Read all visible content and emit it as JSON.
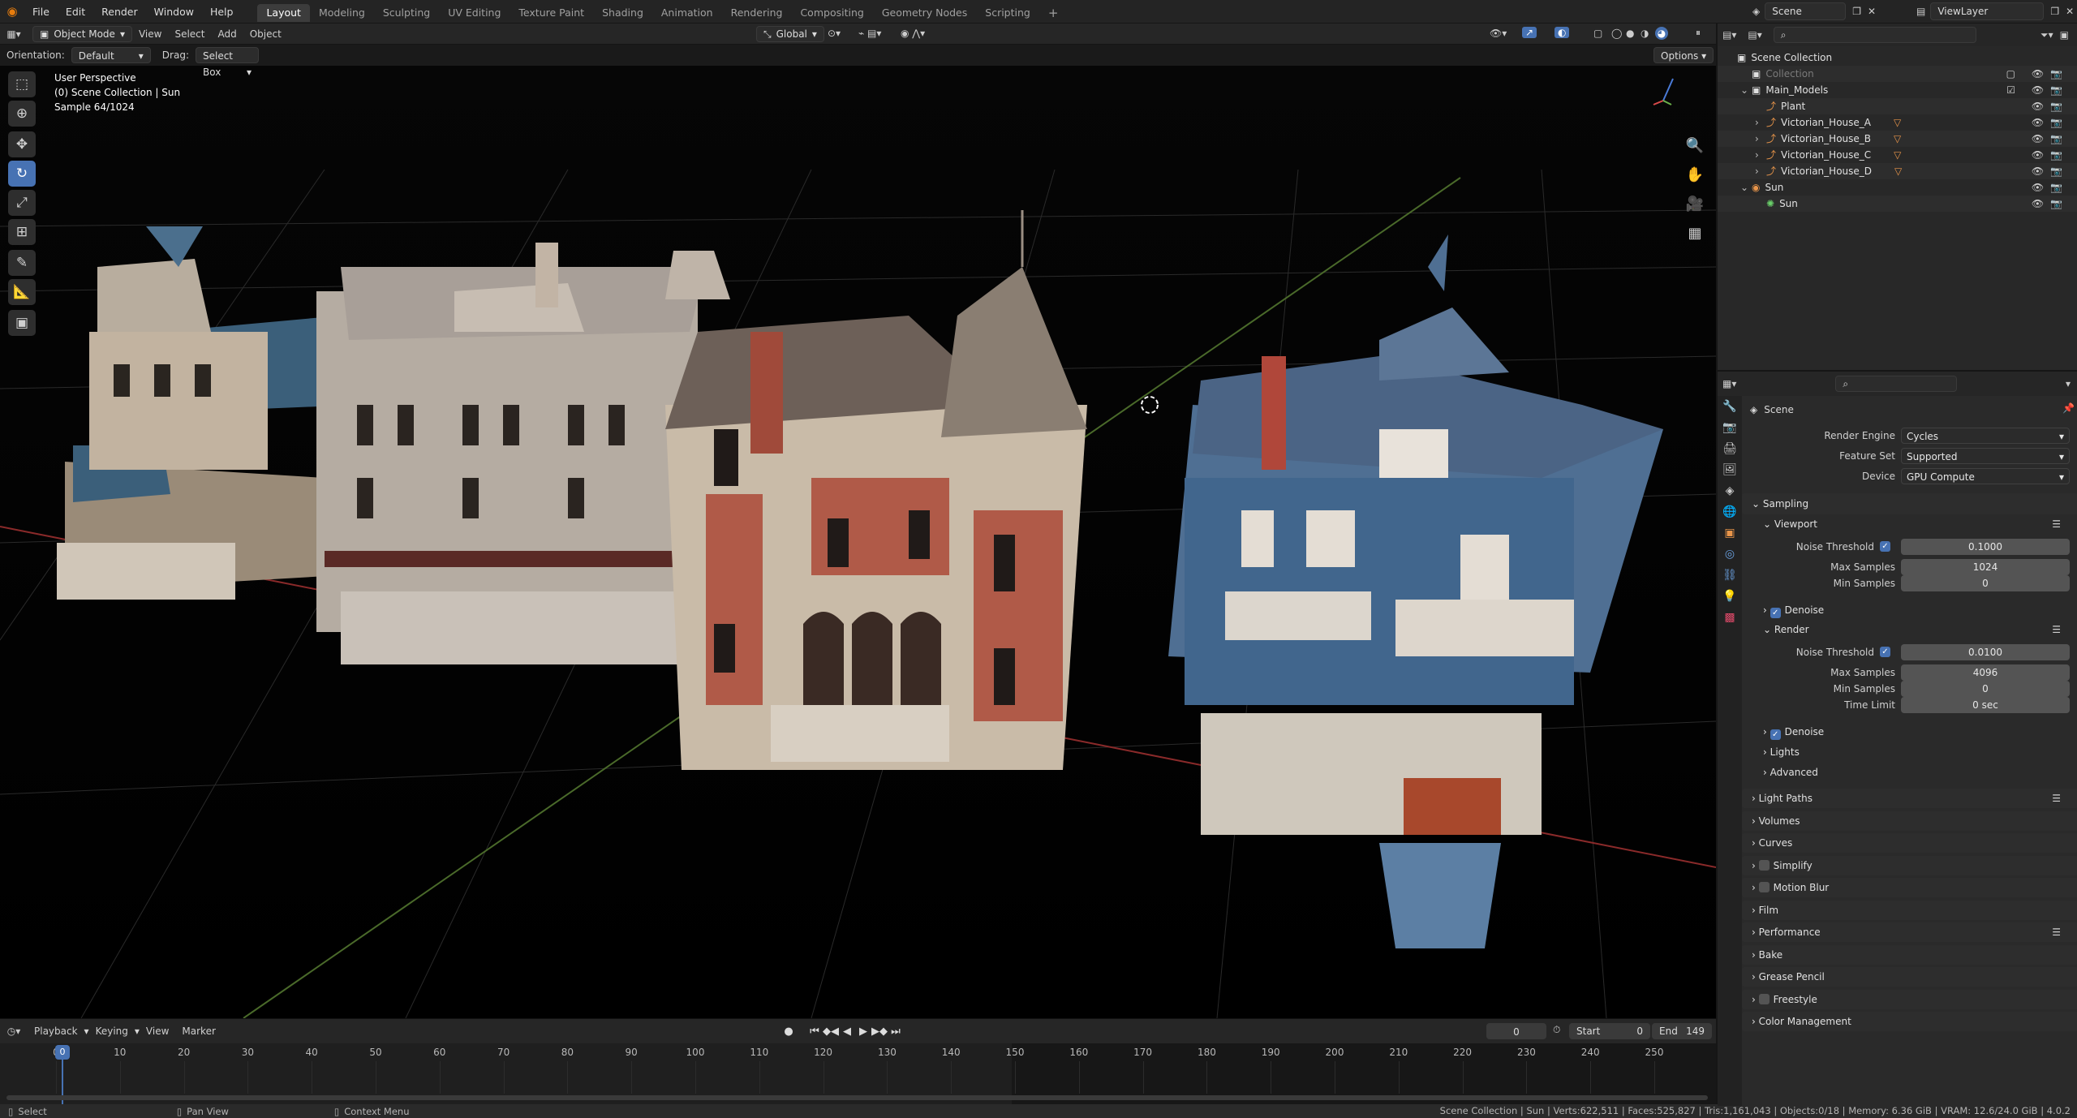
{
  "menus": [
    "File",
    "Edit",
    "Render",
    "Window",
    "Help"
  ],
  "workspaces": [
    "Layout",
    "Modeling",
    "Sculpting",
    "UV Editing",
    "Texture Paint",
    "Shading",
    "Animation",
    "Rendering",
    "Compositing",
    "Geometry Nodes",
    "Scripting"
  ],
  "active_workspace": "Layout",
  "scene_selector": "Scene",
  "viewlayer_selector": "ViewLayer",
  "viewport": {
    "mode": "Object Mode",
    "header_menus": [
      "View",
      "Select",
      "Add",
      "Object"
    ],
    "transform_orientation": "Global",
    "orientation_label": "Orientation:",
    "orientation_value": "Default",
    "drag_label": "Drag:",
    "drag_value": "Select Box",
    "options_label": "Options",
    "overlay_line1": "User Perspective",
    "overlay_line2": "(0) Scene Collection | Sun",
    "overlay_line3": "Sample 64/1024"
  },
  "outliner": {
    "rows": [
      {
        "label": "Scene Collection",
        "indent": 0,
        "icon": "collection"
      },
      {
        "label": "Collection",
        "indent": 1,
        "icon": "collection",
        "dim": true
      },
      {
        "label": "Main_Models",
        "indent": 1,
        "icon": "collection"
      },
      {
        "label": "Plant",
        "indent": 2,
        "icon": "object"
      },
      {
        "label": "Victorian_House_A",
        "indent": 2,
        "icon": "object"
      },
      {
        "label": "Victorian_House_B",
        "indent": 2,
        "icon": "object"
      },
      {
        "label": "Victorian_House_C",
        "indent": 2,
        "icon": "object"
      },
      {
        "label": "Victorian_House_D",
        "indent": 2,
        "icon": "object"
      },
      {
        "label": "Sun",
        "indent": 1,
        "icon": "light"
      },
      {
        "label": "Sun",
        "indent": 2,
        "icon": "light-data"
      }
    ]
  },
  "properties": {
    "context": "Scene",
    "render_engine_label": "Render Engine",
    "render_engine": "Cycles",
    "feature_set_label": "Feature Set",
    "feature_set": "Supported",
    "device_label": "Device",
    "device": "GPU Compute",
    "sampling": "Sampling",
    "viewport": "Viewport",
    "noise_threshold_label": "Noise Threshold",
    "vp_noise_threshold": "0.1000",
    "max_samples_label": "Max Samples",
    "vp_max_samples": "1024",
    "min_samples_label": "Min Samples",
    "vp_min_samples": "0",
    "denoise": "Denoise",
    "render": "Render",
    "r_noise_threshold": "0.0100",
    "r_max_samples": "4096",
    "r_min_samples": "0",
    "time_limit_label": "Time Limit",
    "r_time_limit": "0 sec",
    "lights": "Lights",
    "advanced": "Advanced",
    "sections": [
      "Light Paths",
      "Volumes",
      "Curves",
      "Simplify",
      "Motion Blur",
      "Film",
      "Performance",
      "Bake",
      "Grease Pencil",
      "Freestyle",
      "Color Management"
    ]
  },
  "timeline": {
    "menus": [
      "Playback",
      "Keying",
      "View",
      "Marker"
    ],
    "current_frame": "0",
    "start_label": "Start",
    "start": "0",
    "end_label": "End",
    "end": "149",
    "ticks": [
      "0",
      "10",
      "20",
      "30",
      "40",
      "50",
      "60",
      "70",
      "80",
      "90",
      "100",
      "110",
      "120",
      "130",
      "140",
      "150",
      "160",
      "170",
      "180",
      "190",
      "200",
      "210",
      "220",
      "230",
      "240",
      "250"
    ]
  },
  "status": {
    "select": "Select",
    "pan": "Pan View",
    "context": "Context Menu",
    "stats": "Scene Collection | Sun | Verts:622,511 | Faces:525,827 | Tris:1,161,043 | Objects:0/18 | Memory: 6.36 GiB | VRAM: 12.6/24.0 GiB | 4.0.2"
  }
}
